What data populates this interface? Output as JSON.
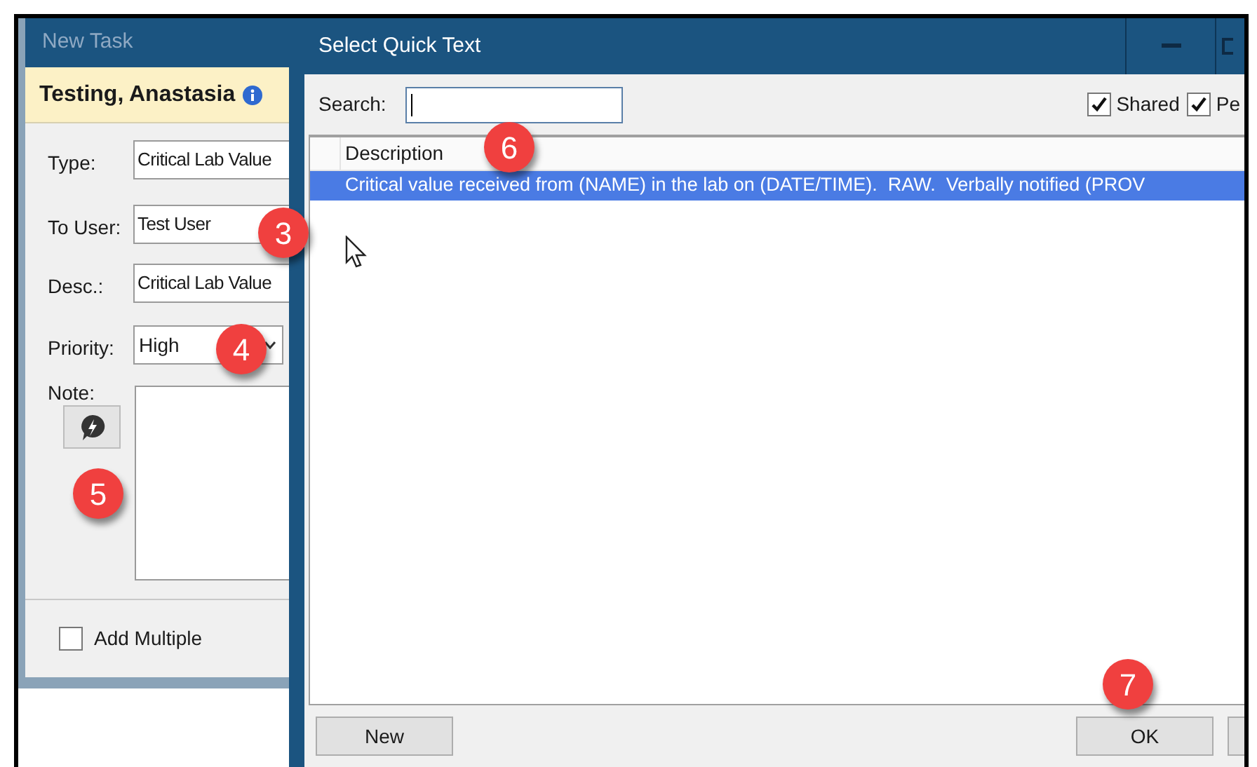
{
  "new_task": {
    "title": "New Task",
    "patient": "Testing, Anastasia",
    "fields": [
      {
        "kind": "text",
        "label": "Type:",
        "value": "Critical Lab Value"
      },
      {
        "kind": "text",
        "label": "To User:",
        "value": "Test User"
      },
      {
        "kind": "text",
        "label": "Desc.:",
        "value": "Critical Lab Value"
      },
      {
        "kind": "select",
        "label": "Priority:",
        "value": "High"
      },
      {
        "kind": "note",
        "label": "Note:"
      }
    ],
    "add_multiple": {
      "label": "Add Multiple",
      "checked": false
    }
  },
  "quick_text": {
    "title": "Select Quick Text",
    "search_label": "Search:",
    "filters": [
      {
        "label": "Shared",
        "checked": true
      },
      {
        "label": "Pe",
        "checked": true
      }
    ],
    "columns": [
      "Description"
    ],
    "rows": [
      {
        "text": "Critical value received from (NAME) in the lab on (DATE/TIME).  RAW.  Verbally notified (PROV",
        "selected": true
      }
    ],
    "buttons": [
      "New",
      "OK"
    ]
  },
  "callouts": [
    "3",
    "4",
    "5",
    "6",
    "7"
  ]
}
